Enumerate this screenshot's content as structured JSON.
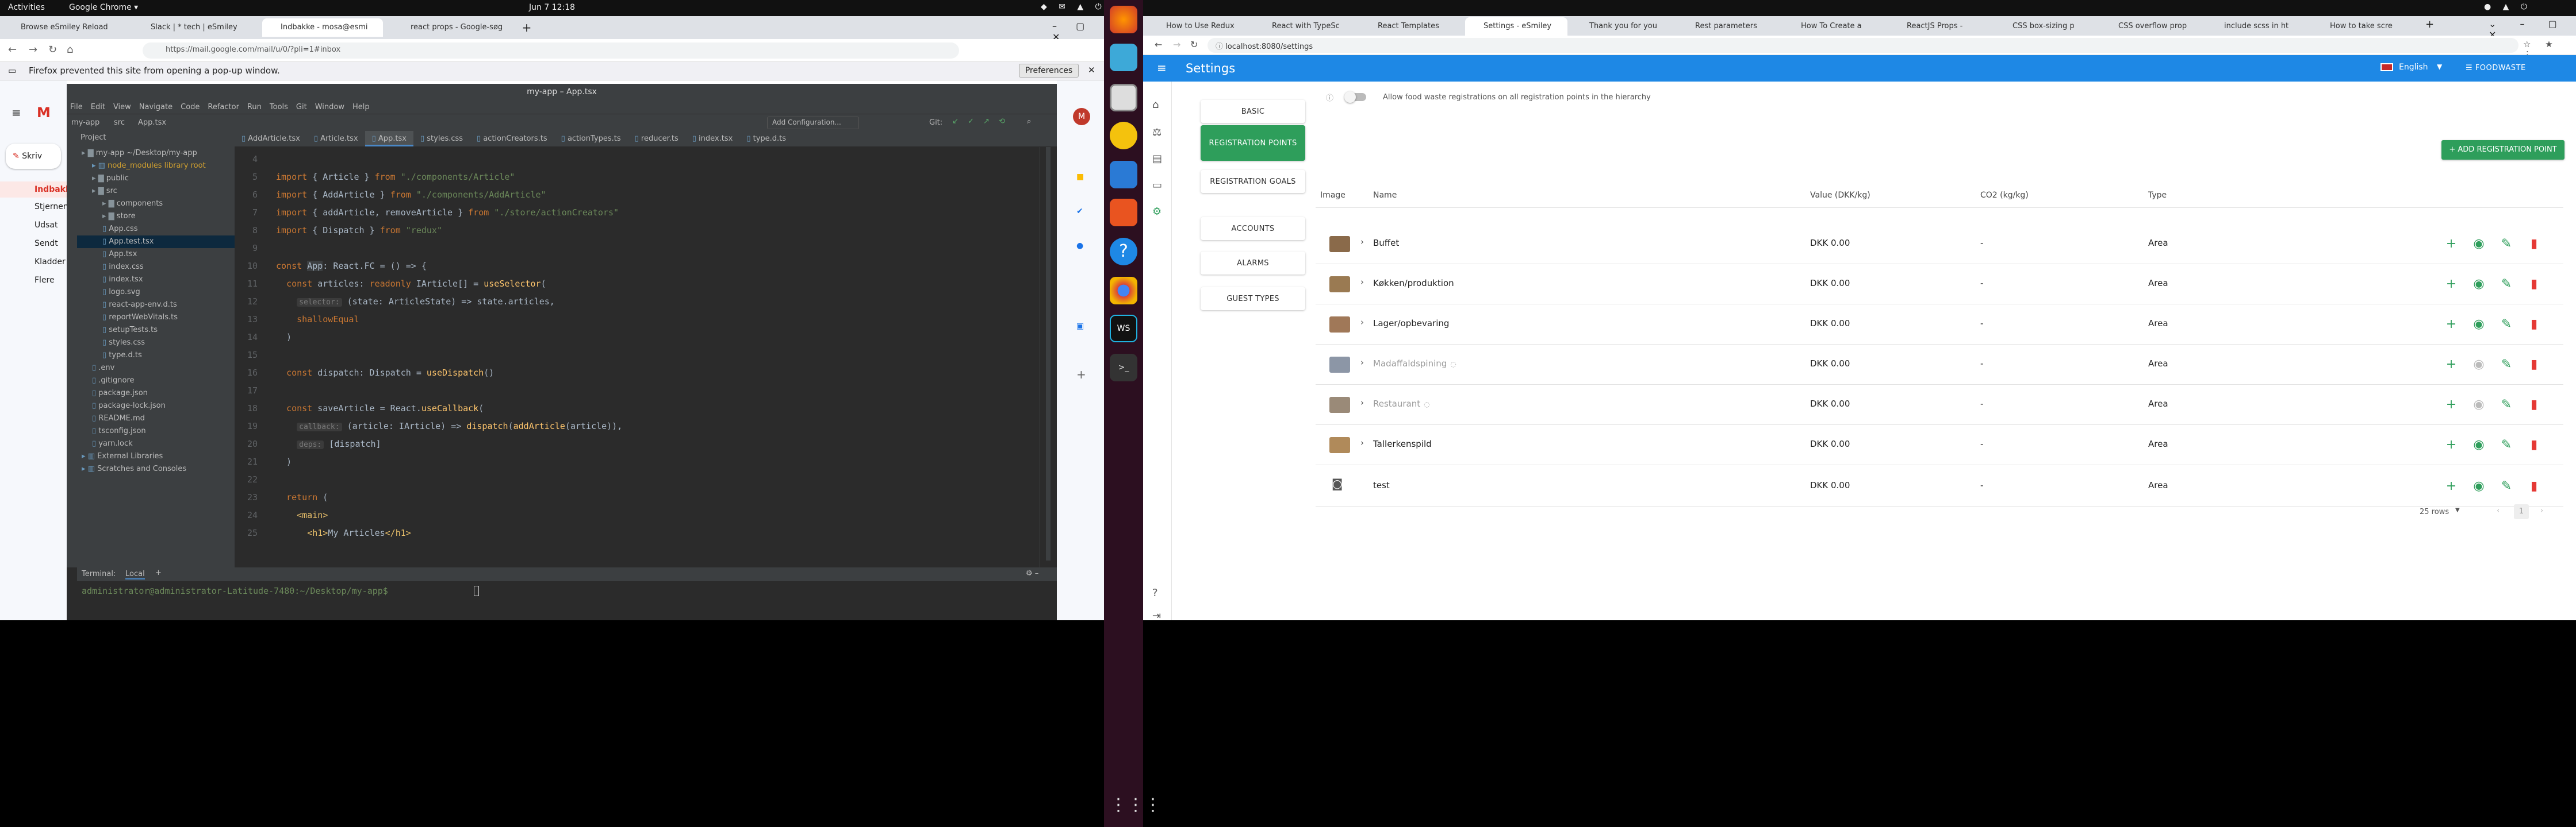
{
  "topbar": {
    "activities": "Activities",
    "app": "Google Chrome ▾",
    "clock": "Jun 7  12:18"
  },
  "left_browser": {
    "tabs": [
      "Browse eSmiley Reload",
      "Slack | * tech | eSmiley",
      "Indbakke - mosa@esmi",
      "react props - Google-søg"
    ],
    "address": "https://mail.google.com/mail/u/0/?pli=1#inbox",
    "popup_notice": "Firefox prevented this site from opening a pop-up window.",
    "preferences": "Preferences",
    "gmail_compose": "Skriv",
    "gmail_folders": [
      "Indbakke",
      "Stjernem",
      "Udsat",
      "Sendt",
      "Kladder",
      "Flere"
    ]
  },
  "ide": {
    "title": "my-app – App.tsx",
    "menu": [
      "File",
      "Edit",
      "View",
      "Navigate",
      "Code",
      "Refactor",
      "Run",
      "Tools",
      "Git",
      "Window",
      "Help"
    ],
    "breadcrumb": [
      "my-app",
      "src",
      "App.tsx"
    ],
    "run_config": "Add Configuration...",
    "git": "Git:",
    "editor_tabs": [
      "AddArticle.tsx",
      "Article.tsx",
      "App.tsx",
      "styles.css",
      "actionCreators.ts",
      "actionTypes.ts",
      "reducer.ts",
      "index.tsx",
      "type.d.ts"
    ],
    "project_label": "Project",
    "tree": [
      {
        "name": "my-app  ~/Desktop/my-app",
        "depth": 0,
        "kind": "folder"
      },
      {
        "name": "node_modules  library root",
        "depth": 1,
        "kind": "lib"
      },
      {
        "name": "public",
        "depth": 1,
        "kind": "folder"
      },
      {
        "name": "src",
        "depth": 1,
        "kind": "folder"
      },
      {
        "name": "components",
        "depth": 2,
        "kind": "folder"
      },
      {
        "name": "store",
        "depth": 2,
        "kind": "folder"
      },
      {
        "name": "App.css",
        "depth": 2,
        "kind": "file"
      },
      {
        "name": "App.test.tsx",
        "depth": 2,
        "kind": "file"
      },
      {
        "name": "App.tsx",
        "depth": 2,
        "kind": "file"
      },
      {
        "name": "index.css",
        "depth": 2,
        "kind": "file"
      },
      {
        "name": "index.tsx",
        "depth": 2,
        "kind": "file"
      },
      {
        "name": "logo.svg",
        "depth": 2,
        "kind": "file"
      },
      {
        "name": "react-app-env.d.ts",
        "depth": 2,
        "kind": "file"
      },
      {
        "name": "reportWebVitals.ts",
        "depth": 2,
        "kind": "file"
      },
      {
        "name": "setupTests.ts",
        "depth": 2,
        "kind": "file"
      },
      {
        "name": "styles.css",
        "depth": 2,
        "kind": "file"
      },
      {
        "name": "type.d.ts",
        "depth": 2,
        "kind": "file"
      },
      {
        "name": ".env",
        "depth": 1,
        "kind": "file"
      },
      {
        "name": ".gitignore",
        "depth": 1,
        "kind": "file"
      },
      {
        "name": "package.json",
        "depth": 1,
        "kind": "file"
      },
      {
        "name": "package-lock.json",
        "depth": 1,
        "kind": "file"
      },
      {
        "name": "README.md",
        "depth": 1,
        "kind": "file"
      },
      {
        "name": "tsconfig.json",
        "depth": 1,
        "kind": "file"
      },
      {
        "name": "yarn.lock",
        "depth": 1,
        "kind": "file"
      },
      {
        "name": "External Libraries",
        "depth": 0,
        "kind": "lib"
      },
      {
        "name": "Scratches and Consoles",
        "depth": 0,
        "kind": "lib"
      }
    ],
    "code": [
      {
        "n": "4",
        "html": ""
      },
      {
        "n": "5",
        "html": "<span class='kw'>import</span> { Article } <span class='kw'>from</span> <span class='str'>\"./components/Article\"</span>"
      },
      {
        "n": "6",
        "html": "<span class='kw'>import</span> { AddArticle } <span class='kw'>from</span> <span class='str'>\"./components/AddArticle\"</span>"
      },
      {
        "n": "7",
        "html": "<span class='kw'>import</span> { addArticle, removeArticle } <span class='kw'>from</span> <span class='str'>\"./store/actionCreators\"</span>"
      },
      {
        "n": "8",
        "html": "<span class='kw'>import</span> { Dispatch } <span class='kw'>from</span> <span class='str'>\"redux\"</span>"
      },
      {
        "n": "9",
        "html": ""
      },
      {
        "n": "10",
        "html": "<span class='kw'>const</span> <span style='background:#3c3f41'>App</span>: React.FC = () => {"
      },
      {
        "n": "11",
        "html": "  <span class='kw'>const</span> articles: <span class='kw'>readonly</span> IArticle[] = <span class='fn'>useSelector</span>("
      },
      {
        "n": "12",
        "html": "    <span class='hint'>selector:</span> (state: ArticleState) => state.articles,"
      },
      {
        "n": "13",
        "html": "    <span class='kw'>shallowEqual</span>"
      },
      {
        "n": "14",
        "html": "  )"
      },
      {
        "n": "15",
        "html": ""
      },
      {
        "n": "16",
        "html": "  <span class='kw'>const</span> dispatch: Dispatch<any> = <span class='fn'>useDispatch</span>()"
      },
      {
        "n": "17",
        "html": ""
      },
      {
        "n": "18",
        "html": "  <span class='kw'>const</span> saveArticle = React.<span class='fn'>useCallback</span>("
      },
      {
        "n": "19",
        "html": "    <span class='hint'>callback:</span> (article: IArticle) => <span class='fn'>dispatch</span>(<span class='fn'>addArticle</span>(article)),"
      },
      {
        "n": "20",
        "html": "    <span class='hint'>deps:</span> [dispatch]"
      },
      {
        "n": "21",
        "html": "  )"
      },
      {
        "n": "22",
        "html": ""
      },
      {
        "n": "23",
        "html": "  <span class='kw'>return</span> ("
      },
      {
        "n": "24",
        "html": "    <span class='tag'>&lt;main&gt;</span>"
      },
      {
        "n": "25",
        "html": "      <span class='tag'>&lt;h1&gt;</span>My Articles<span class='tag'>&lt;/h1&gt;</span>"
      }
    ],
    "terminal_label": "Terminal:",
    "terminal_tab": "Local",
    "prompt": "administrator@administrator-Latitude-7480:~/Desktop/my-app$"
  },
  "right_browser": {
    "tabs": [
      "How to Use Redux",
      "React with TypeSc",
      "React Templates",
      "Settings - eSmiley",
      "Thank you for you",
      "Rest parameters",
      "How To Create a",
      "ReactJS Props -",
      "CSS box-sizing p",
      "CSS overflow prop",
      "include scss in ht",
      "How to take scre"
    ],
    "address": "localhost:8080/settings"
  },
  "app": {
    "title": "Settings",
    "language": "English",
    "brand": "FOODWASTE",
    "side_buttons": [
      "BASIC",
      "REGISTRATION POINTS",
      "REGISTRATION GOALS",
      "ACCOUNTS",
      "ALARMS",
      "GUEST TYPES"
    ],
    "active_side": 1,
    "toggle_label": "Allow food waste registrations on all registration points in the hierarchy",
    "add_button": "+ ADD REGISTRATION POINT",
    "columns": [
      "Image",
      "Name",
      "Value (DKK/kg)",
      "CO2 (kg/kg)",
      "Type"
    ],
    "rows": [
      {
        "name": "Buffet",
        "value": "DKK 0.00",
        "co2": "-",
        "type": "Area",
        "hidden": false,
        "thumb": "#8a6a4a"
      },
      {
        "name": "Køkken/produktion",
        "value": "DKK 0.00",
        "co2": "-",
        "type": "Area",
        "hidden": false,
        "thumb": "#9a7a52"
      },
      {
        "name": "Lager/opbevaring",
        "value": "DKK 0.00",
        "co2": "-",
        "type": "Area",
        "hidden": false,
        "thumb": "#a07858"
      },
      {
        "name": "Madaffaldspining",
        "value": "DKK 0.00",
        "co2": "-",
        "type": "Area",
        "hidden": true,
        "thumb": "#8c96a6"
      },
      {
        "name": "Restaurant",
        "value": "DKK 0.00",
        "co2": "-",
        "type": "Area",
        "hidden": true,
        "thumb": "#9a8a78"
      },
      {
        "name": "Tallerkenspild",
        "value": "DKK 0.00",
        "co2": "-",
        "type": "Area",
        "hidden": false,
        "thumb": "#b08a5a"
      },
      {
        "name": "test",
        "value": "DKK 0.00",
        "co2": "-",
        "type": "Area",
        "hidden": false,
        "thumb": ""
      }
    ],
    "rows_per_page": "25 rows",
    "page": "1",
    "colors": {
      "primary": "#1e88e5",
      "green": "#2e9e5b",
      "danger": "#e53935"
    }
  }
}
